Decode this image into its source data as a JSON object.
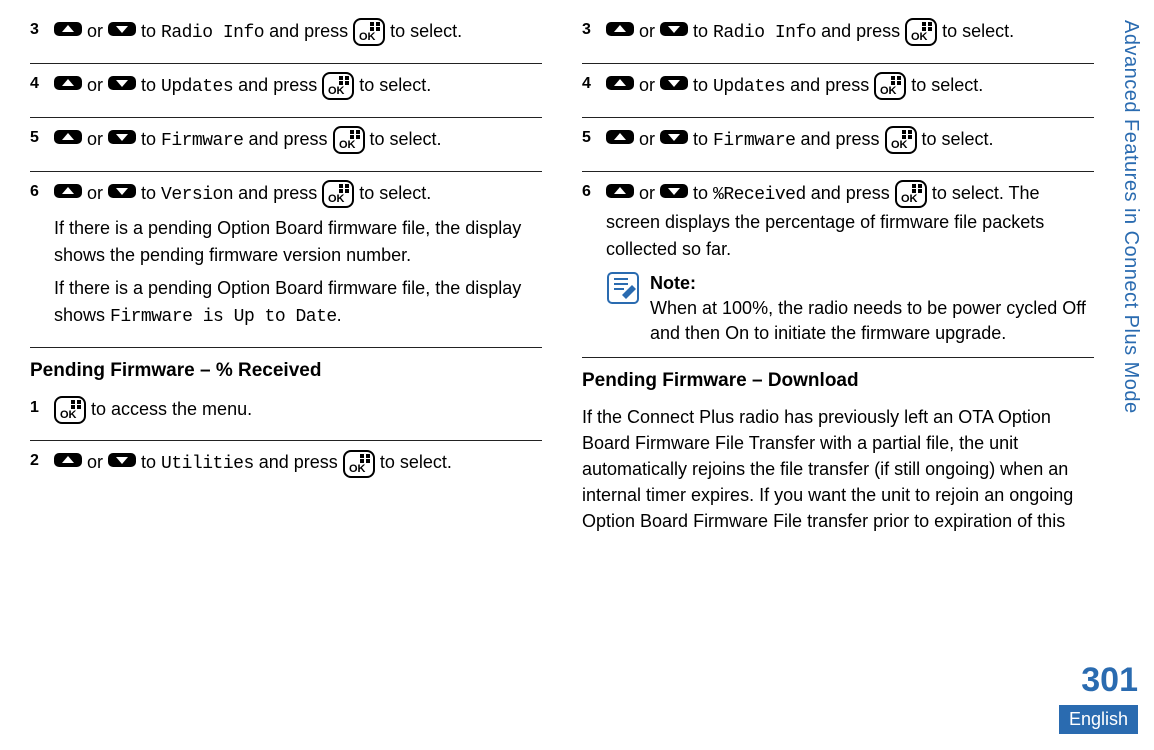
{
  "side_tab": "Advanced Features in Connect Plus Mode",
  "page_number": "301",
  "language": "English",
  "left": {
    "steps": [
      {
        "num": "3",
        "pre": " or ",
        "mid": " to ",
        "target": "Radio Info",
        "post": " and press ",
        "tail": " to select."
      },
      {
        "num": "4",
        "pre": " or ",
        "mid": " to ",
        "target": "Updates",
        "post": " and press ",
        "tail": " to select."
      },
      {
        "num": "5",
        "pre": " or ",
        "mid": " to ",
        "target": "Firmware",
        "post": " and press ",
        "tail": " to select."
      },
      {
        "num": "6",
        "pre": " or ",
        "mid": " to ",
        "target": "Version",
        "post": " and press ",
        "tail": " to select.",
        "extra1": "If there is a pending Option Board firmware file, the display shows the pending firmware version number.",
        "extra2a": "If there is a pending Option Board firmware file, the display shows ",
        "extra2mono": "Firmware is Up to Date",
        "extra2b": "."
      }
    ],
    "heading1": "Pending Firmware – % Received",
    "steps2": [
      {
        "num": "1",
        "tail": " to access the menu."
      },
      {
        "num": "2",
        "pre": " or ",
        "mid": " to ",
        "target": "Utilities",
        "post": " and press ",
        "tail": " to select."
      }
    ]
  },
  "right": {
    "steps": [
      {
        "num": "3",
        "pre": " or ",
        "mid": " to ",
        "target": "Radio Info",
        "post": " and press ",
        "tail": " to select."
      },
      {
        "num": "4",
        "pre": " or ",
        "mid": " to ",
        "target": "Updates",
        "post": " and press ",
        "tail": " to select."
      },
      {
        "num": "5",
        "pre": " or ",
        "mid": " to ",
        "target": "Firmware",
        "post": " and press ",
        "tail": " to select."
      },
      {
        "num": "6",
        "pre": " or ",
        "mid": " to ",
        "target": "%Received",
        "post": " and press ",
        "tail": " to select. The screen displays the percentage of firmware file packets collected so far.",
        "note_label": "Note:",
        "note_text": "When at 100%, the radio needs to be power cycled Off and then On to initiate the firmware upgrade."
      }
    ],
    "heading1": "Pending Firmware – Download",
    "para1": "If the Connect Plus radio has previously left an OTA Option Board Firmware File Transfer with a partial file, the unit automatically rejoins the file transfer (if still ongoing) when an internal timer expires. If you want the unit to rejoin an ongoing Option Board Firmware File transfer prior to expiration of this"
  }
}
